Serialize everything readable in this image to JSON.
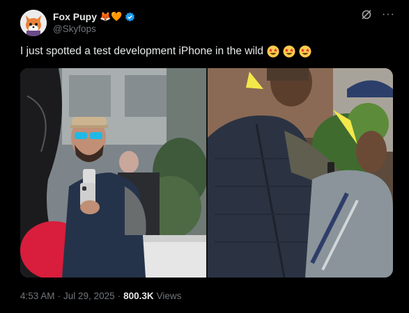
{
  "author": {
    "display_name": "Fox Pupy",
    "name_emojis": "🦊🧡",
    "handle": "@Skyfops",
    "avatar_icon": "fox-avatar-icon",
    "verified_color": "#1d9bf0"
  },
  "actions": {
    "grok_icon": "grok-icon",
    "more_label": "···"
  },
  "tweet": {
    "text": "I just spotted a test development iPhone in the wild",
    "emojis": [
      "star-struck",
      "star-struck",
      "star-struck"
    ]
  },
  "media": {
    "photos": [
      {
        "icon": "photo-man-holding-phones-icon"
      },
      {
        "icon": "photo-men-with-phone-icon"
      }
    ]
  },
  "meta": {
    "time": "4:53 AM",
    "date": "Jul 29, 2025",
    "sep": "·",
    "views_count": "800.3K",
    "views_label": "Views"
  }
}
